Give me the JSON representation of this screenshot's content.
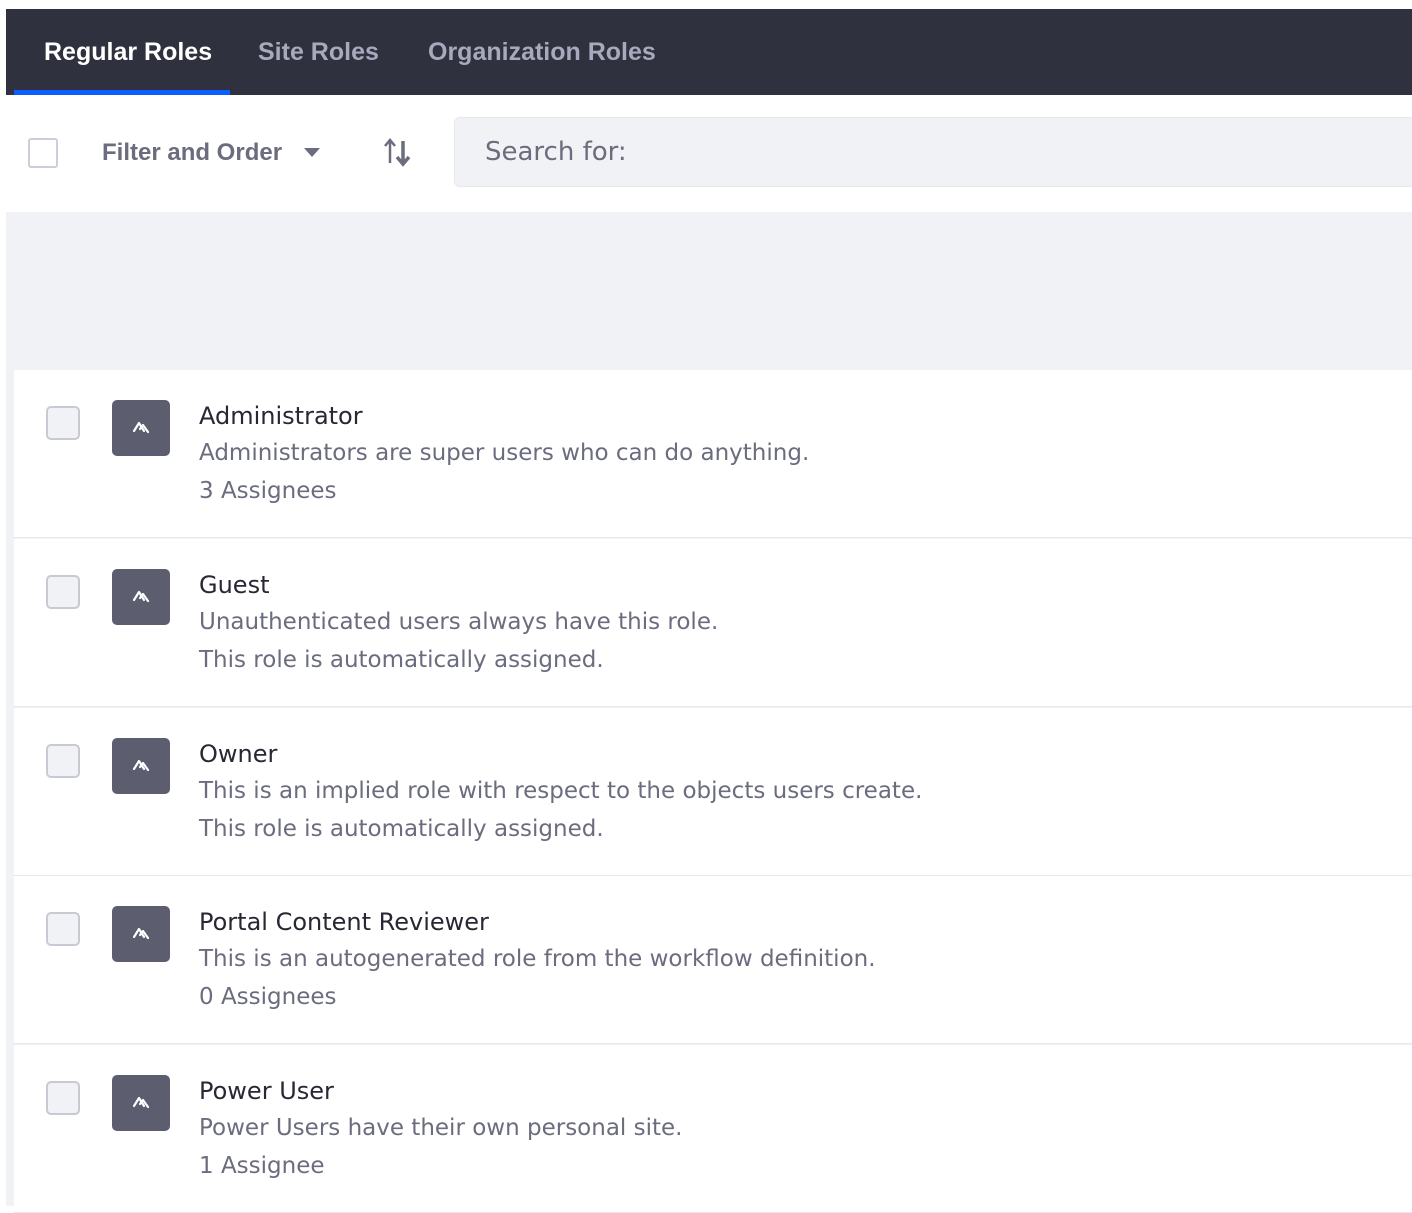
{
  "tabs": [
    {
      "label": "Regular Roles",
      "active": true
    },
    {
      "label": "Site Roles",
      "active": false
    },
    {
      "label": "Organization Roles",
      "active": false
    }
  ],
  "toolbar": {
    "filter_label": "Filter and Order",
    "filter_icon": "caret-down-icon",
    "sort_icon": "order-arrows-icon",
    "search_placeholder": "Search for:"
  },
  "roles": [
    {
      "title": "Administrator",
      "description": "Administrators are super users who can do anything.",
      "meta": "3 Assignees",
      "icon": "user-role-icon"
    },
    {
      "title": "Guest",
      "description": "Unauthenticated users always have this role.",
      "meta": "This role is automatically assigned.",
      "icon": "user-role-icon"
    },
    {
      "title": "Owner",
      "description": "This is an implied role with respect to the objects users create.",
      "meta": "This role is automatically assigned.",
      "icon": "user-role-icon"
    },
    {
      "title": "Portal Content Reviewer",
      "description": "This is an autogenerated role from the workflow definition.",
      "meta": "0 Assignees",
      "icon": "user-role-icon"
    },
    {
      "title": "Power User",
      "description": "Power Users have their own personal site.",
      "meta": "1 Assignee",
      "icon": "user-role-icon"
    }
  ],
  "colors": {
    "tabbar_bg": "#30313f",
    "tab_active_indicator": "#0b5fff",
    "sticker_bg": "#5c5e70",
    "panel_bg": "#f1f2f5"
  }
}
